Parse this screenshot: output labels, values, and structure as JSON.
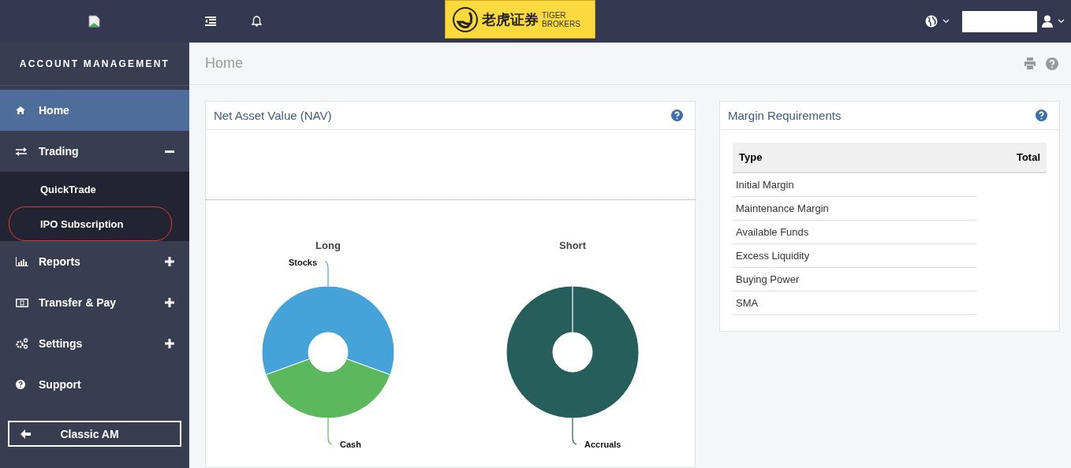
{
  "header": {
    "broken_image": true,
    "logo": {
      "chinese": "老虎证券",
      "english_1": "TIGER",
      "english_2": "BROKERS"
    }
  },
  "sidebar": {
    "title": "ACCOUNT MANAGEMENT",
    "items": [
      {
        "label": "Home",
        "kind": "link",
        "selected": true
      },
      {
        "label": "Trading",
        "kind": "group",
        "selected": false,
        "expanded": true,
        "children": [
          {
            "label": "QuickTrade",
            "highlighted": false
          },
          {
            "label": "IPO Subscription",
            "highlighted": true
          }
        ]
      },
      {
        "label": "Reports",
        "kind": "group",
        "selected": false,
        "expanded": false
      },
      {
        "label": "Transfer & Pay",
        "kind": "group",
        "selected": false,
        "expanded": false
      },
      {
        "label": "Settings",
        "kind": "group",
        "selected": false,
        "expanded": false
      },
      {
        "label": "Support",
        "kind": "link",
        "selected": false
      }
    ],
    "button": "Classic AM"
  },
  "page_title": "Home",
  "nav_panel": {
    "title": "Net Asset Value (NAV)",
    "donuts": [
      {
        "title": "Long",
        "slices": [
          {
            "label": "Stocks",
            "color": "#46a3da"
          },
          {
            "label": "Cash",
            "color": "#5cb85c"
          }
        ]
      },
      {
        "title": "Short",
        "slices": [
          {
            "label": "Accruals",
            "color": "#265e5b"
          }
        ]
      }
    ]
  },
  "margin_panel": {
    "title": "Margin Requirements",
    "columns": [
      "Type",
      "Total"
    ],
    "rows": [
      "Initial Margin",
      "Maintenance Margin",
      "Available Funds",
      "Excess Liquidity",
      "Buying Power",
      "SMA"
    ]
  }
}
